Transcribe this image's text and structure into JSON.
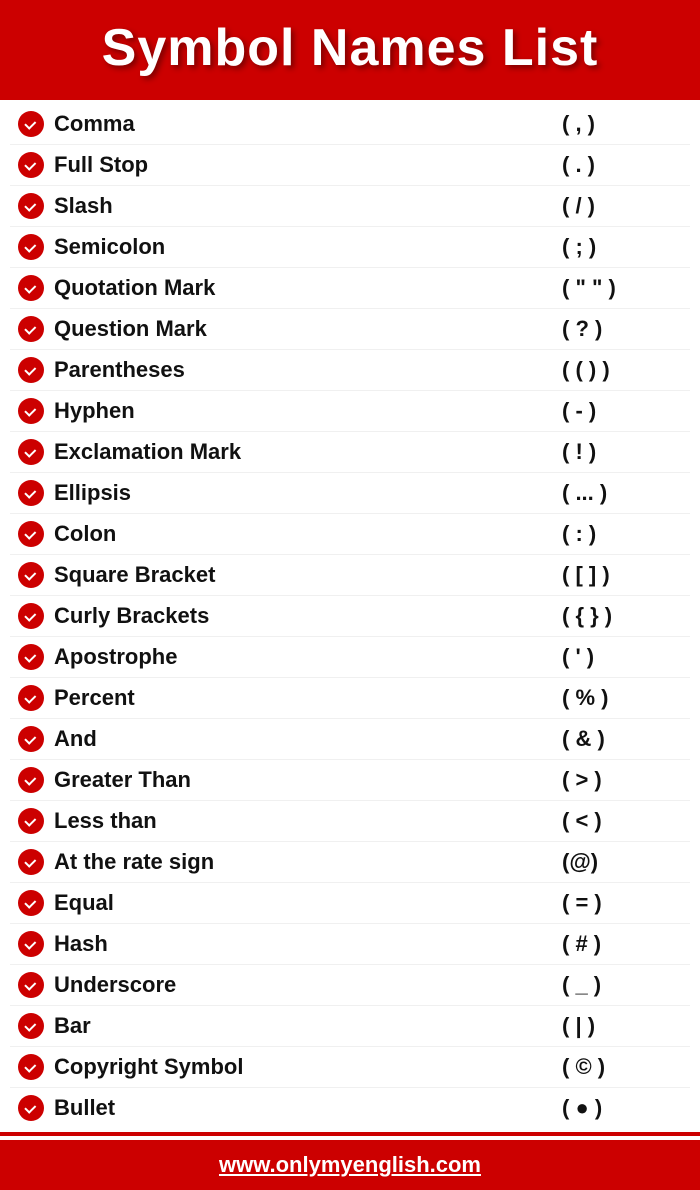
{
  "header": {
    "title": "Symbol Names List"
  },
  "items": [
    {
      "name": "Comma",
      "symbol": "( , )"
    },
    {
      "name": "Full Stop",
      "symbol": "( . )"
    },
    {
      "name": "Slash",
      "symbol": "( / )"
    },
    {
      "name": "Semicolon",
      "symbol": "( ; )"
    },
    {
      "name": "Quotation Mark",
      "symbol": "( \" \" )"
    },
    {
      "name": "Question Mark",
      "symbol": "( ? )"
    },
    {
      "name": "Parentheses",
      "symbol": "( ( ) )"
    },
    {
      "name": "Hyphen",
      "symbol": "( - )"
    },
    {
      "name": "Exclamation Mark",
      "symbol": "( ! )"
    },
    {
      "name": "Ellipsis",
      "symbol": "( ... )"
    },
    {
      "name": "Colon",
      "symbol": "( : )"
    },
    {
      "name": "Square Bracket",
      "symbol": "( [ ] )"
    },
    {
      "name": "Curly Brackets",
      "symbol": "( { } )"
    },
    {
      "name": "Apostrophe",
      "symbol": "( ' )"
    },
    {
      "name": "Percent",
      "symbol": "( % )"
    },
    {
      "name": "And",
      "symbol": "( & )"
    },
    {
      "name": "Greater Than",
      "symbol": "( > )"
    },
    {
      "name": "Less than",
      "symbol": "( < )"
    },
    {
      "name": "At the rate sign",
      "symbol": "(@)"
    },
    {
      "name": "Equal",
      "symbol": "( = )"
    },
    {
      "name": "Hash",
      "symbol": "( # )"
    },
    {
      "name": "Underscore",
      "symbol": "( _ )"
    },
    {
      "name": "Bar",
      "symbol": "( | )"
    },
    {
      "name": "Copyright Symbol",
      "symbol": "( © )"
    },
    {
      "name": "Bullet",
      "symbol": "( ● )"
    }
  ],
  "footer": {
    "url": "www.onlymyenglish.com"
  }
}
